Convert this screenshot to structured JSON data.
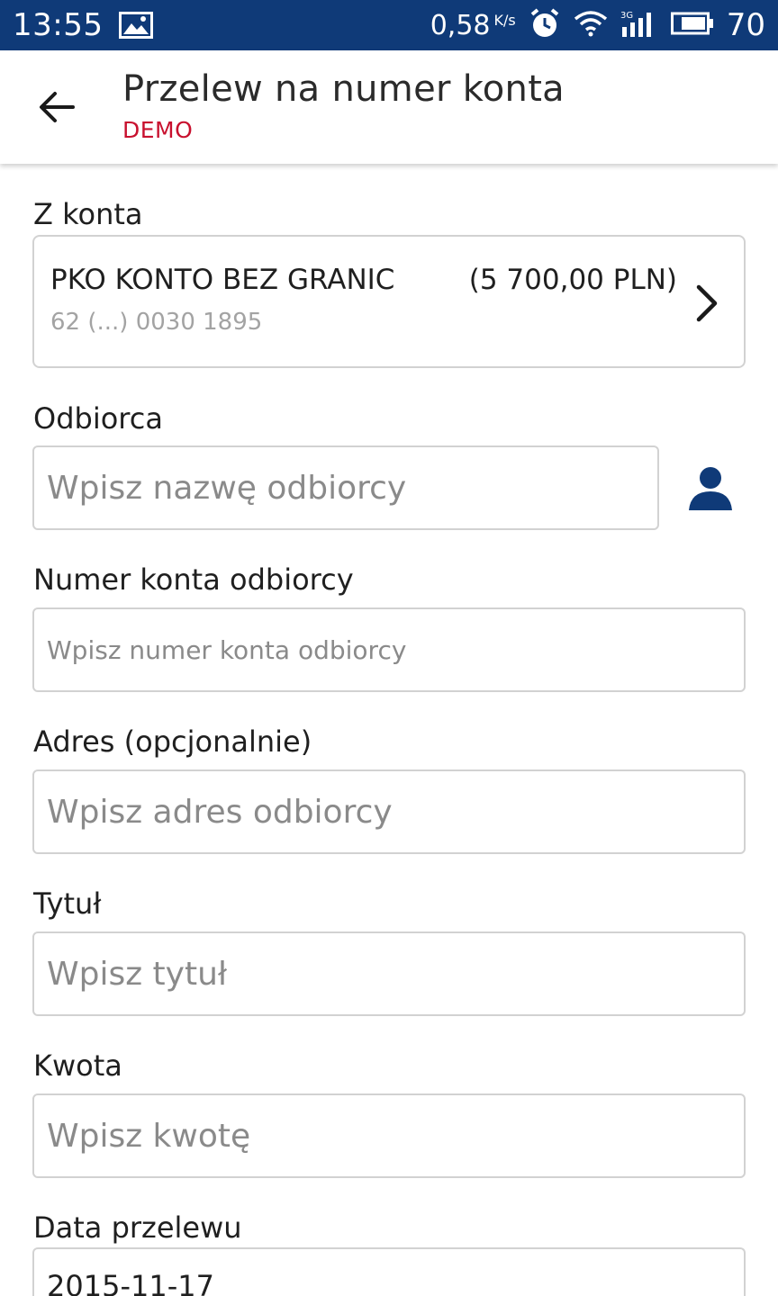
{
  "status_bar": {
    "time": "13:55",
    "speed_value": "0,58",
    "speed_unit": "K/s",
    "battery": "70",
    "icons": [
      "image-icon",
      "alarm-icon",
      "wifi-icon",
      "signal-3g-icon",
      "battery-icon"
    ]
  },
  "app_bar": {
    "title": "Przelew na numer konta",
    "subtitle": "DEMO",
    "back_icon": "arrow-left-icon"
  },
  "form": {
    "from_account": {
      "label": "Z konta",
      "name": "PKO KONTO BEZ GRANIC",
      "balance": "(5 700,00 PLN)",
      "number": "62 (...) 0030 1895",
      "icon": "chevron-right-icon"
    },
    "recipient": {
      "label": "Odbiorca",
      "placeholder": "Wpisz nazwę odbiorcy",
      "value": "",
      "icon": "contact-person-icon"
    },
    "account_number": {
      "label": "Numer konta odbiorcy",
      "placeholder": "Wpisz numer konta odbiorcy",
      "value": ""
    },
    "address": {
      "label": "Adres (opcjonalnie)",
      "placeholder": "Wpisz adres odbiorcy",
      "value": ""
    },
    "title": {
      "label": "Tytuł",
      "placeholder": "Wpisz tytuł",
      "value": ""
    },
    "amount": {
      "label": "Kwota",
      "placeholder": "Wpisz kwotę",
      "value": ""
    },
    "date": {
      "label": "Data przelewu",
      "value": "2015-11-17"
    }
  },
  "colors": {
    "status_bar": "#0f3a78",
    "subtitle": "#c8102e",
    "contact_icon": "#0f3a78",
    "field_border": "#d2d2d2",
    "placeholder": "#8a8a8a"
  }
}
